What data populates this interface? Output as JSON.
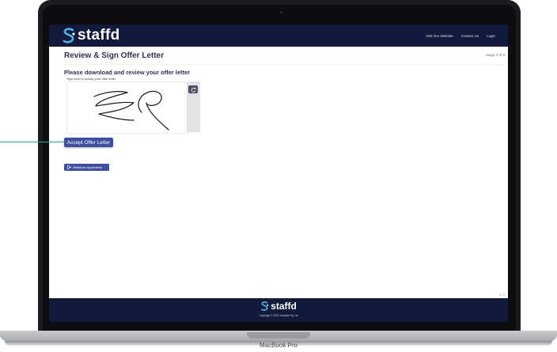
{
  "device": {
    "model_label": "MacBook Pro"
  },
  "header": {
    "brand": "staffd",
    "nav": [
      "Visit Our Website",
      "Contact Us",
      "Login"
    ]
  },
  "page": {
    "title": "Review & Sign Offer Letter",
    "stage": "Stage 3 of 3",
    "heading": "Please download and review your offer letter",
    "sign_label": "Sign here to accept your offer letter",
    "accept_label": "Accept Offer Letter",
    "withdraw_label": "Withdraw Application",
    "version": "v1.3"
  },
  "footer": {
    "brand": "staffd",
    "copyright": "Copyright © 2021 Solvable Pty Ltd"
  },
  "colors": {
    "navy": "#121a3c",
    "button": "#3f4fa0",
    "callout": "#2aa7a0"
  },
  "icons": [
    "staffd-logo-icon",
    "refresh-icon",
    "exit-icon"
  ]
}
